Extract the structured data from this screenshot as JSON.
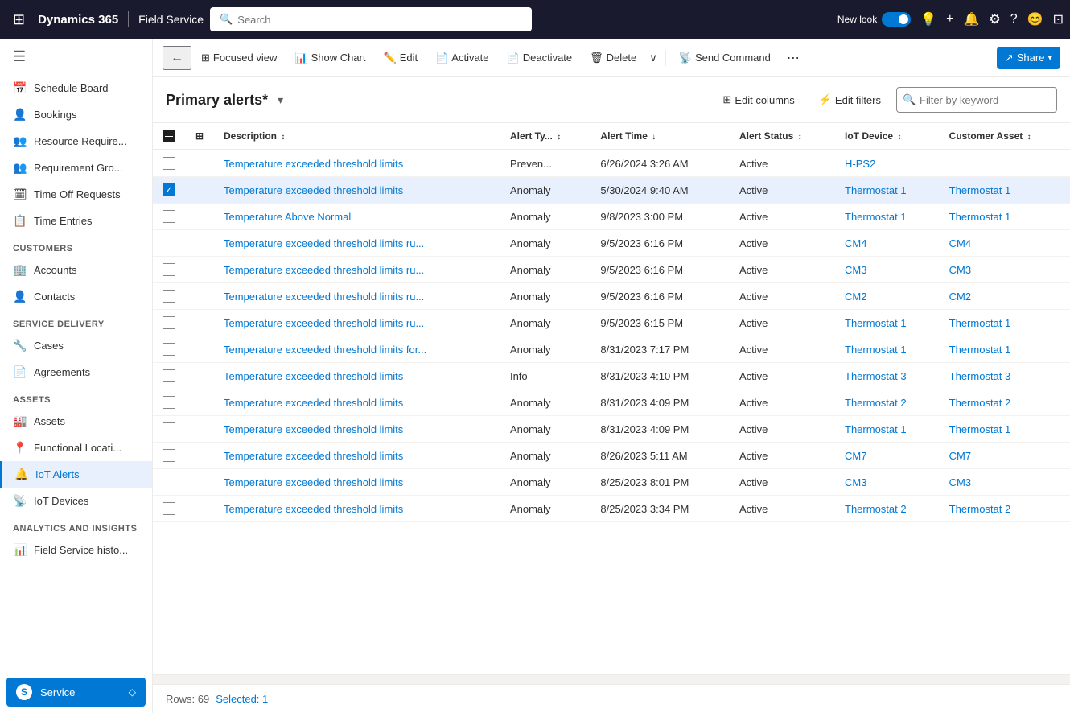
{
  "topNav": {
    "waffle": "⊞",
    "brand": "Dynamics 365",
    "divider": true,
    "appName": "Field Service",
    "searchPlaceholder": "Search",
    "newLookLabel": "New look",
    "icons": [
      "💡",
      "+",
      "🔔",
      "⚙",
      "?",
      "😊",
      "⊡"
    ]
  },
  "sidebar": {
    "hamburger": "☰",
    "items": [
      {
        "id": "schedule-board",
        "icon": "📅",
        "label": "Schedule Board"
      },
      {
        "id": "bookings",
        "icon": "👤",
        "label": "Bookings"
      },
      {
        "id": "resource-require",
        "icon": "👥",
        "label": "Resource Require..."
      },
      {
        "id": "requirement-gro",
        "icon": "👥",
        "label": "Requirement Gro..."
      },
      {
        "id": "time-off-requests",
        "icon": "🗓",
        "label": "Time Off Requests"
      },
      {
        "id": "time-entries",
        "icon": "📋",
        "label": "Time Entries"
      }
    ],
    "sections": [
      {
        "title": "Customers",
        "items": [
          {
            "id": "accounts",
            "icon": "🏢",
            "label": "Accounts"
          },
          {
            "id": "contacts",
            "icon": "👤",
            "label": "Contacts"
          }
        ]
      },
      {
        "title": "Service Delivery",
        "items": [
          {
            "id": "cases",
            "icon": "🔧",
            "label": "Cases"
          },
          {
            "id": "agreements",
            "icon": "📄",
            "label": "Agreements"
          }
        ]
      },
      {
        "title": "Assets",
        "items": [
          {
            "id": "assets",
            "icon": "🏭",
            "label": "Assets"
          },
          {
            "id": "functional-locati",
            "icon": "📍",
            "label": "Functional Locati..."
          },
          {
            "id": "iot-alerts",
            "icon": "🔔",
            "label": "IoT Alerts",
            "active": true
          },
          {
            "id": "iot-devices",
            "icon": "📡",
            "label": "IoT Devices"
          }
        ]
      },
      {
        "title": "Analytics and Insights",
        "items": [
          {
            "id": "field-service-histo",
            "icon": "📊",
            "label": "Field Service histo..."
          }
        ]
      }
    ],
    "bottomItem": {
      "id": "service",
      "icon": "S",
      "label": "Service",
      "pin": "◇"
    }
  },
  "toolbar": {
    "back": "←",
    "focusedView": "Focused view",
    "showChart": "Show Chart",
    "edit": "Edit",
    "activate": "Activate",
    "deactivate": "Deactivate",
    "delete": "Delete",
    "more": "∨",
    "sendCommand": "Send Command",
    "moreOptions": "⋯",
    "share": "Share"
  },
  "grid": {
    "title": "Primary alerts*",
    "editColumns": "Edit columns",
    "editFilters": "Edit filters",
    "filterPlaceholder": "Filter by keyword",
    "columns": [
      {
        "id": "description",
        "label": "Description",
        "sortable": true,
        "sort": "none"
      },
      {
        "id": "alertType",
        "label": "Alert Ty...",
        "sortable": true
      },
      {
        "id": "alertTime",
        "label": "Alert Time",
        "sortable": true,
        "sort": "desc"
      },
      {
        "id": "alertStatus",
        "label": "Alert Status",
        "sortable": true
      },
      {
        "id": "iotDevice",
        "label": "IoT Device",
        "sortable": true
      },
      {
        "id": "customerAsset",
        "label": "Customer Asset",
        "sortable": true
      }
    ],
    "rows": [
      {
        "id": 1,
        "checked": false,
        "description": "Temperature exceeded threshold limits",
        "alertType": "Preven...",
        "alertTime": "6/26/2024 3:26 AM",
        "alertStatus": "Active",
        "iotDevice": "H-PS2",
        "iotDeviceLink": true,
        "customerAsset": "",
        "customerAssetLink": false,
        "selected": false
      },
      {
        "id": 2,
        "checked": true,
        "description": "Temperature exceeded threshold limits",
        "alertType": "Anomaly",
        "alertTime": "5/30/2024 9:40 AM",
        "alertStatus": "Active",
        "iotDevice": "Thermostat 1",
        "iotDeviceLink": true,
        "customerAsset": "Thermostat 1",
        "customerAssetLink": true,
        "selected": true
      },
      {
        "id": 3,
        "checked": false,
        "description": "Temperature Above Normal",
        "alertType": "Anomaly",
        "alertTime": "9/8/2023 3:00 PM",
        "alertStatus": "Active",
        "iotDevice": "Thermostat 1",
        "iotDeviceLink": true,
        "customerAsset": "Thermostat 1",
        "customerAssetLink": true,
        "selected": false
      },
      {
        "id": 4,
        "checked": false,
        "description": "Temperature exceeded threshold limits ru...",
        "alertType": "Anomaly",
        "alertTime": "9/5/2023 6:16 PM",
        "alertStatus": "Active",
        "iotDevice": "CM4",
        "iotDeviceLink": true,
        "customerAsset": "CM4",
        "customerAssetLink": true,
        "selected": false
      },
      {
        "id": 5,
        "checked": false,
        "description": "Temperature exceeded threshold limits ru...",
        "alertType": "Anomaly",
        "alertTime": "9/5/2023 6:16 PM",
        "alertStatus": "Active",
        "iotDevice": "CM3",
        "iotDeviceLink": true,
        "customerAsset": "CM3",
        "customerAssetLink": true,
        "selected": false
      },
      {
        "id": 6,
        "checked": false,
        "description": "Temperature exceeded threshold limits ru...",
        "alertType": "Anomaly",
        "alertTime": "9/5/2023 6:16 PM",
        "alertStatus": "Active",
        "iotDevice": "CM2",
        "iotDeviceLink": true,
        "customerAsset": "CM2",
        "customerAssetLink": true,
        "selected": false
      },
      {
        "id": 7,
        "checked": false,
        "description": "Temperature exceeded threshold limits ru...",
        "alertType": "Anomaly",
        "alertTime": "9/5/2023 6:15 PM",
        "alertStatus": "Active",
        "iotDevice": "Thermostat 1",
        "iotDeviceLink": true,
        "customerAsset": "Thermostat 1",
        "customerAssetLink": true,
        "selected": false
      },
      {
        "id": 8,
        "checked": false,
        "description": "Temperature exceeded threshold limits for...",
        "alertType": "Anomaly",
        "alertTime": "8/31/2023 7:17 PM",
        "alertStatus": "Active",
        "iotDevice": "Thermostat 1",
        "iotDeviceLink": true,
        "customerAsset": "Thermostat 1",
        "customerAssetLink": true,
        "selected": false
      },
      {
        "id": 9,
        "checked": false,
        "description": "Temperature exceeded threshold limits",
        "alertType": "Info",
        "alertTime": "8/31/2023 4:10 PM",
        "alertStatus": "Active",
        "iotDevice": "Thermostat 3",
        "iotDeviceLink": true,
        "customerAsset": "Thermostat 3",
        "customerAssetLink": true,
        "selected": false
      },
      {
        "id": 10,
        "checked": false,
        "description": "Temperature exceeded threshold limits",
        "alertType": "Anomaly",
        "alertTime": "8/31/2023 4:09 PM",
        "alertStatus": "Active",
        "iotDevice": "Thermostat 2",
        "iotDeviceLink": true,
        "customerAsset": "Thermostat 2",
        "customerAssetLink": true,
        "selected": false
      },
      {
        "id": 11,
        "checked": false,
        "description": "Temperature exceeded threshold limits",
        "alertType": "Anomaly",
        "alertTime": "8/31/2023 4:09 PM",
        "alertStatus": "Active",
        "iotDevice": "Thermostat 1",
        "iotDeviceLink": true,
        "customerAsset": "Thermostat 1",
        "customerAssetLink": true,
        "selected": false
      },
      {
        "id": 12,
        "checked": false,
        "description": "Temperature exceeded threshold limits",
        "alertType": "Anomaly",
        "alertTime": "8/26/2023 5:11 AM",
        "alertStatus": "Active",
        "iotDevice": "CM7",
        "iotDeviceLink": true,
        "customerAsset": "CM7",
        "customerAssetLink": true,
        "selected": false
      },
      {
        "id": 13,
        "checked": false,
        "description": "Temperature exceeded threshold limits",
        "alertType": "Anomaly",
        "alertTime": "8/25/2023 8:01 PM",
        "alertStatus": "Active",
        "iotDevice": "CM3",
        "iotDeviceLink": true,
        "customerAsset": "CM3",
        "customerAssetLink": true,
        "selected": false
      },
      {
        "id": 14,
        "checked": false,
        "description": "Temperature exceeded threshold limits",
        "alertType": "Anomaly",
        "alertTime": "8/25/2023 3:34 PM",
        "alertStatus": "Active",
        "iotDevice": "Thermostat 2",
        "iotDeviceLink": true,
        "customerAsset": "Thermostat 2",
        "customerAssetLink": true,
        "selected": false
      }
    ],
    "footer": {
      "rows": "Rows: 69",
      "selected": "Selected: 1"
    }
  }
}
